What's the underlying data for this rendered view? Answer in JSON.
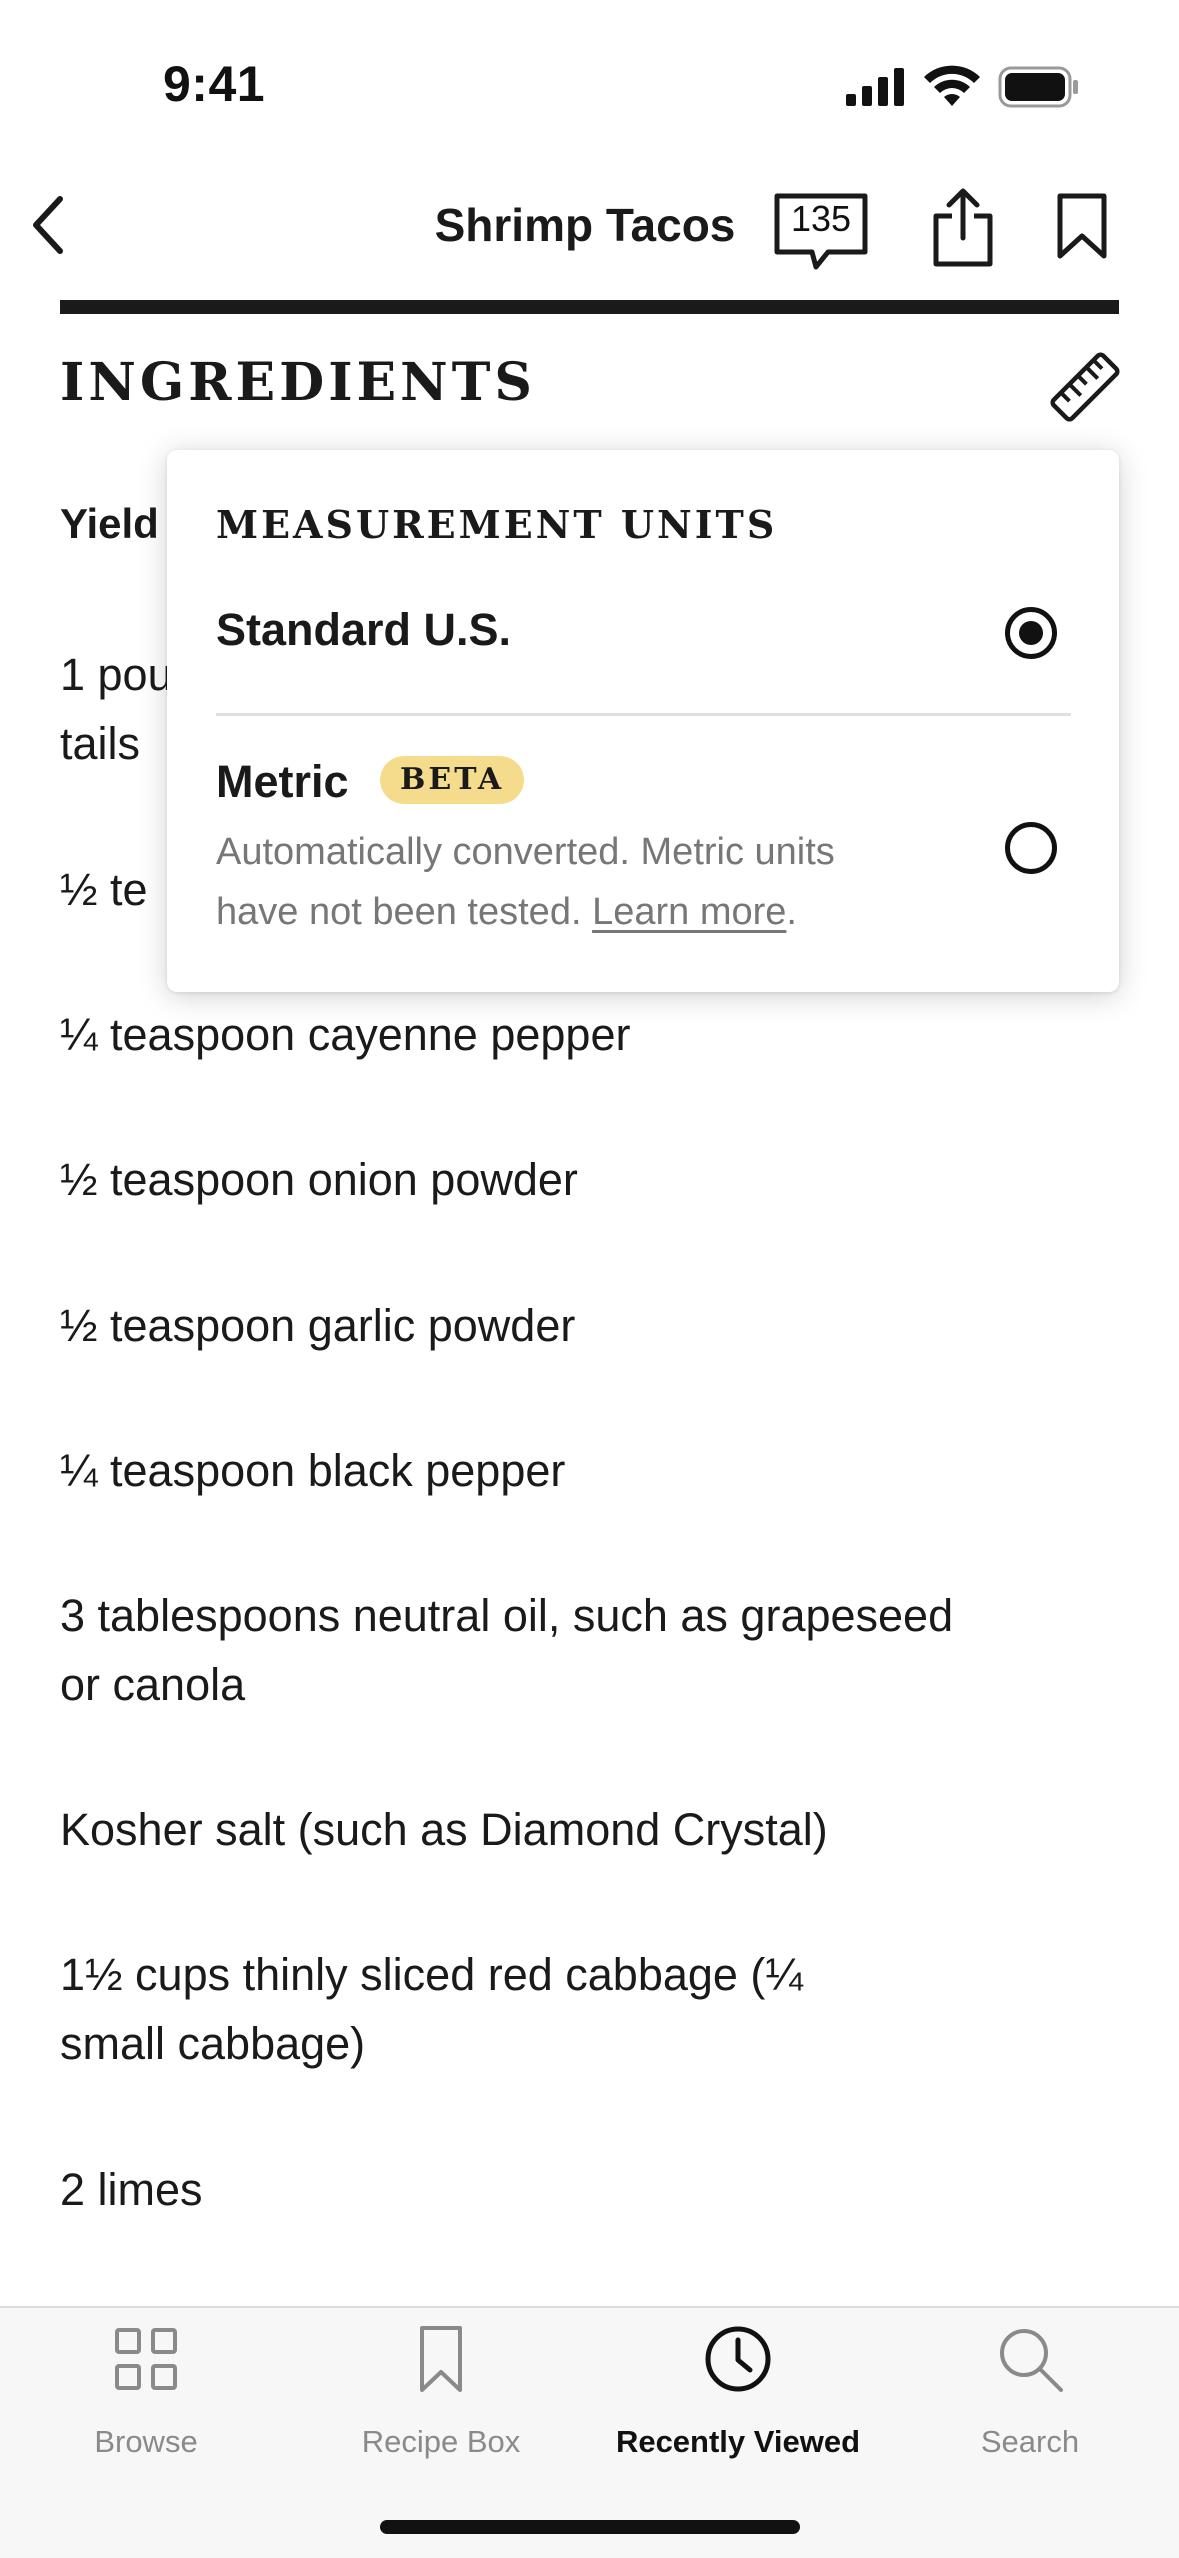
{
  "status_bar": {
    "time": "9:41"
  },
  "nav": {
    "title": "Shrimp Tacos",
    "comments_count": "135",
    "icons": [
      "back-chevron-icon",
      "comment-bubble-icon",
      "share-icon",
      "bookmark-icon"
    ]
  },
  "section": {
    "title": "INGREDIENTS",
    "units_icon": "ruler-icon"
  },
  "yield_label": "Yield",
  "ingredients": [
    {
      "lines": [
        "1 pou",
        "tails"
      ]
    },
    {
      "lines": [
        "½ te"
      ]
    },
    {
      "lines": [
        "¼ teaspoon cayenne pepper"
      ]
    },
    {
      "lines": [
        "½ teaspoon onion powder"
      ]
    },
    {
      "lines": [
        "½ teaspoon garlic powder"
      ]
    },
    {
      "lines": [
        "¼ teaspoon black pepper"
      ]
    },
    {
      "lines": [
        "3 tablespoons neutral oil, such as grapeseed",
        "or canola"
      ]
    },
    {
      "lines": [
        "Kosher salt (such as Diamond Crystal)"
      ]
    },
    {
      "lines": [
        "1½ cups thinly sliced red cabbage (¼",
        "small cabbage)"
      ]
    },
    {
      "lines": [
        "2 limes"
      ]
    }
  ],
  "units_popover": {
    "heading": "MEASUREMENT UNITS",
    "options": [
      {
        "label": "Standard U.S.",
        "selected": true
      },
      {
        "label": "Metric",
        "selected": false,
        "badge": "BETA",
        "description_line1": "Automatically converted. Metric units",
        "description_line2_prefix": "have not been tested. ",
        "link": "Learn more",
        "description_line2_suffix": "."
      }
    ]
  },
  "tab_bar": {
    "tabs": [
      {
        "label": "Browse",
        "icon": "grid-icon",
        "active": false
      },
      {
        "label": "Recipe Box",
        "icon": "bookmark-icon",
        "active": false
      },
      {
        "label": "Recently Viewed",
        "icon": "clock-icon",
        "active": true
      },
      {
        "label": "Search",
        "icon": "search-icon",
        "active": false
      }
    ]
  },
  "colors": {
    "text": "#1a1a1a",
    "muted_text": "#777777",
    "beta_badge": "#f5dc8d",
    "tab_inactive": "#8a8a8a",
    "tab_bar_bg": "#f7f7f7"
  }
}
